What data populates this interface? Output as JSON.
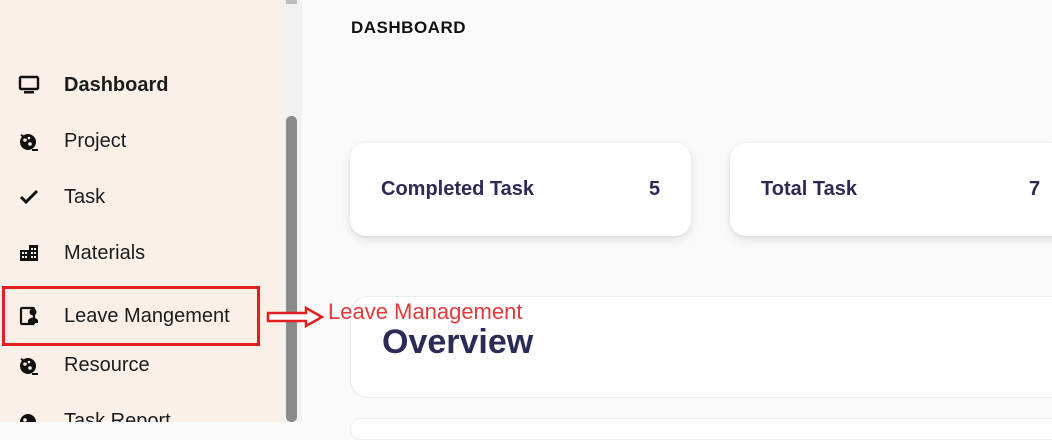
{
  "sidebar": {
    "items": [
      {
        "label": "Dashboard",
        "icon": "monitor-icon"
      },
      {
        "label": "Project",
        "icon": "project-icon"
      },
      {
        "label": "Task",
        "icon": "check-icon"
      },
      {
        "label": "Materials",
        "icon": "materials-icon"
      },
      {
        "label": "Leave Mangement",
        "icon": "leave-icon"
      },
      {
        "label": "Resource",
        "icon": "resource-icon"
      },
      {
        "label": "Task Report",
        "icon": "report-icon"
      }
    ]
  },
  "header": {
    "title": "DASHBOARD"
  },
  "cards": [
    {
      "label": "Completed Task",
      "value": "5"
    },
    {
      "label": "Total Task",
      "value": "7"
    }
  ],
  "overview": {
    "title": "Overview"
  },
  "annotation": {
    "text": "Leave Management",
    "color": "#e03a3a"
  },
  "colors": {
    "sidebar_bg": "#faf0e8",
    "accent_text": "#2b2b55",
    "highlight": "#e02020"
  }
}
